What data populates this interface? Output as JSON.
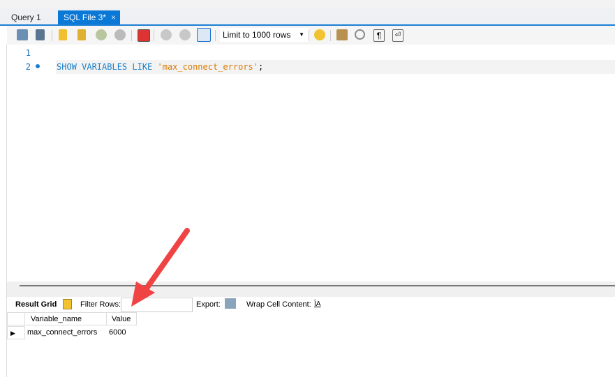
{
  "tabs": [
    {
      "label": "Query 1"
    },
    {
      "label": "SQL File 3*",
      "close": "×"
    }
  ],
  "toolbar": {
    "limit_label": "Limit to 1000 rows",
    "icons": [
      "open-folder-icon",
      "save-icon",
      "execute-icon",
      "execute-current-icon",
      "explain-icon",
      "stop-icon",
      "toggle-error-icon",
      "commit-icon",
      "rollback-icon",
      "autocommit-icon",
      "add-snippet-icon",
      "beautify-icon",
      "find-icon",
      "invisible-chars-icon",
      "word-wrap-icon"
    ]
  },
  "editor": {
    "lines": [
      "1",
      "2"
    ],
    "code_keyword": "SHOW VARIABLES LIKE ",
    "code_string": "'max_connect_errors'",
    "code_end": ";"
  },
  "results": {
    "result_grid_label": "Result Grid",
    "filter_label": "Filter Rows:",
    "filter_value": "",
    "export_label": "Export:",
    "wrap_label": "Wrap Cell Content:",
    "columns": [
      "Variable_name",
      "Value"
    ],
    "rows": [
      [
        "max_connect_errors",
        "6000"
      ]
    ]
  },
  "colors": {
    "accent": "#0a78d6",
    "string": "#d97800",
    "keyword": "#1a7fc9",
    "arrow": "#f04040"
  }
}
